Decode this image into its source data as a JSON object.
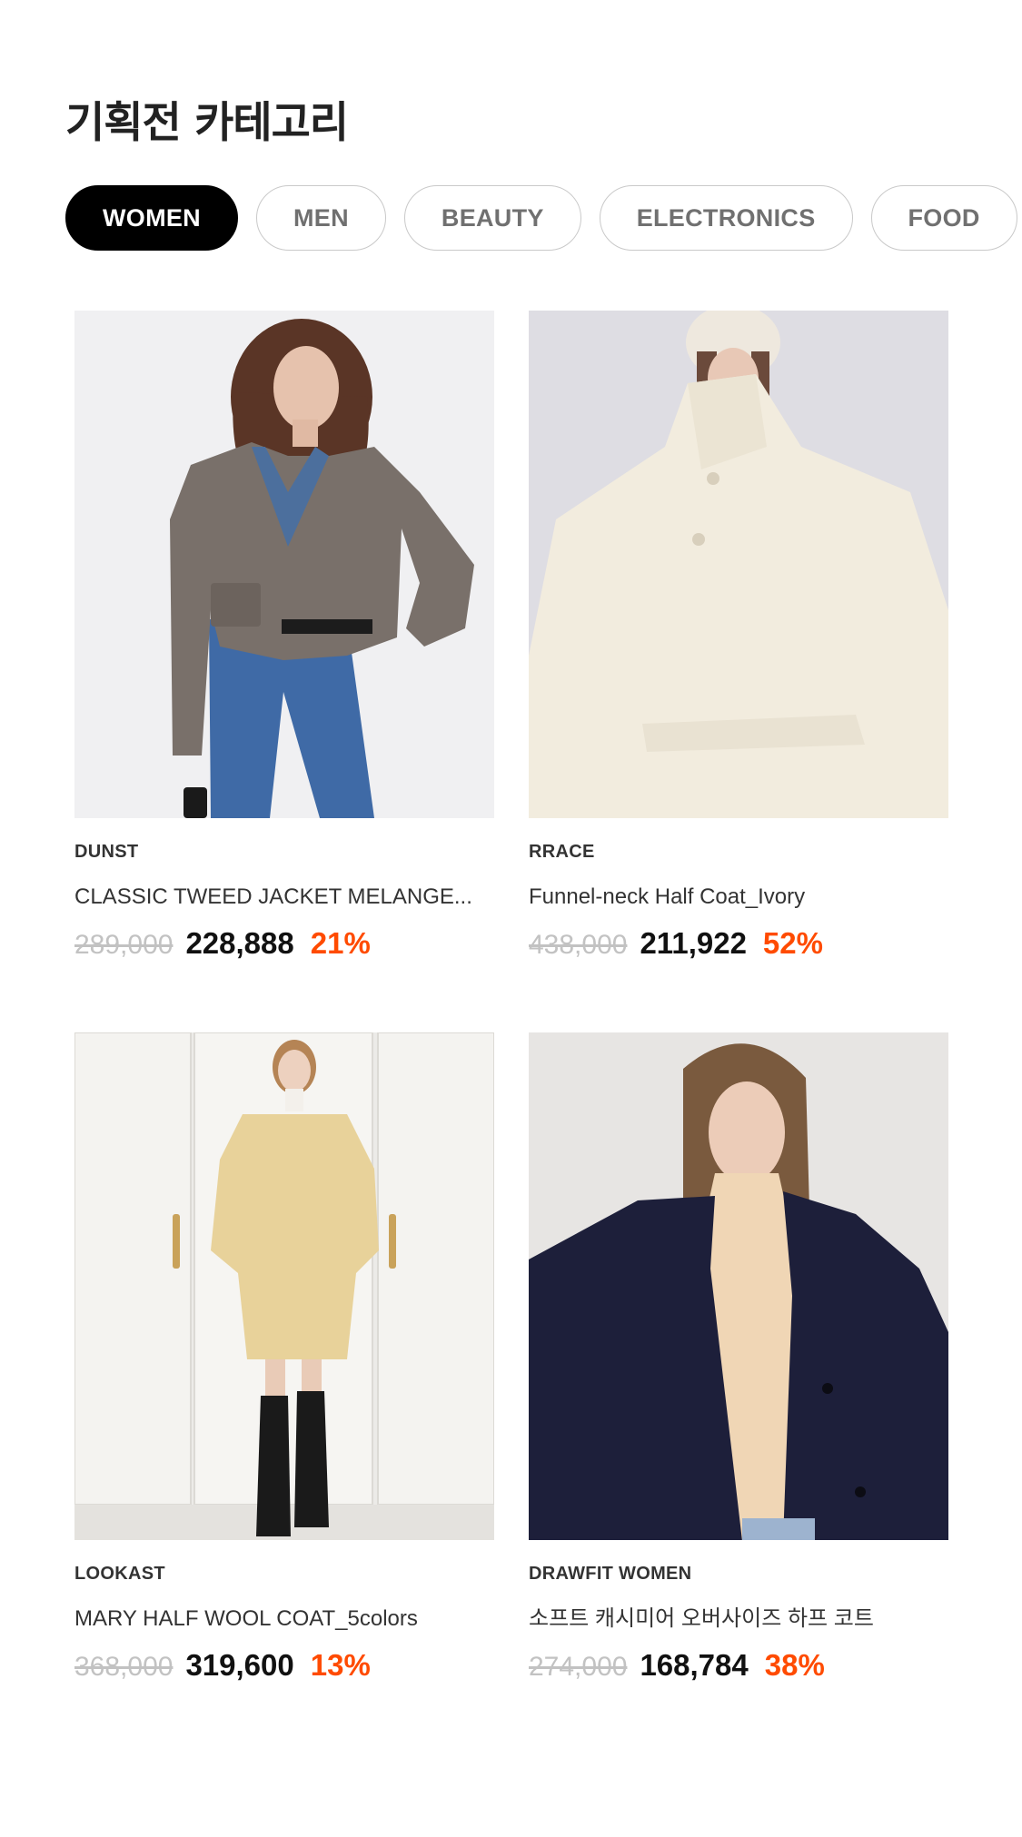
{
  "section": {
    "title": "기획전 카테고리"
  },
  "tabs": [
    {
      "label": "WOMEN",
      "active": true
    },
    {
      "label": "MEN",
      "active": false
    },
    {
      "label": "BEAUTY",
      "active": false
    },
    {
      "label": "ELECTRONICS",
      "active": false
    },
    {
      "label": "FOOD",
      "active": false
    }
  ],
  "products": [
    {
      "brand": "DUNST",
      "name": "CLASSIC TWEED JACKET MELANGE...",
      "original_price": "289,000",
      "sale_price": "228,888",
      "discount": "21%",
      "image": "product-photo-gray-tweed-jacket"
    },
    {
      "brand": "RRACE",
      "name": "Funnel-neck Half Coat_Ivory",
      "original_price": "438,000",
      "sale_price": "211,922",
      "discount": "52%",
      "image": "product-photo-ivory-funnel-neck-coat"
    },
    {
      "brand": "LOOKAST",
      "name": "MARY HALF WOOL COAT_5colors",
      "original_price": "368,000",
      "sale_price": "319,600",
      "discount": "13%",
      "image": "product-photo-butter-wool-half-coat"
    },
    {
      "brand": "DRAWFIT WOMEN",
      "name": "소프트 캐시미어 오버사이즈 하프 코트",
      "original_price": "274,000",
      "sale_price": "168,784",
      "discount": "38%",
      "image": "product-photo-navy-cashmere-coat"
    }
  ],
  "colors": {
    "active_tab_bg": "#000000",
    "discount": "#ff4b00",
    "original_price": "#c2c2c2"
  }
}
